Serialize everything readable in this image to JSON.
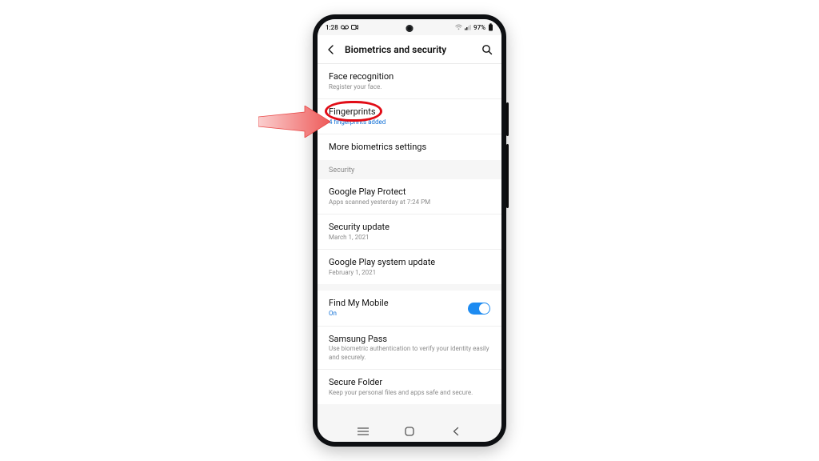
{
  "status": {
    "time": "1:28",
    "battery_pct": "97%"
  },
  "header": {
    "title": "Biometrics and security"
  },
  "items": {
    "face": {
      "title": "Face recognition",
      "sub": "Register your face."
    },
    "finger": {
      "title": "Fingerprints",
      "sub": "4 fingerprints added"
    },
    "more_bio": {
      "title": "More biometrics settings"
    },
    "section_security": "Security",
    "play_protect": {
      "title": "Google Play Protect",
      "sub": "Apps scanned yesterday at 7:24 PM"
    },
    "sec_update": {
      "title": "Security update",
      "sub": "March 1, 2021"
    },
    "play_sys_update": {
      "title": "Google Play system update",
      "sub": "February 1, 2021"
    },
    "find_mobile": {
      "title": "Find My Mobile",
      "sub": "On"
    },
    "samsung_pass": {
      "title": "Samsung Pass",
      "sub": "Use biometric authentication to verify your identity easily and securely."
    },
    "secure_folder": {
      "title": "Secure Folder",
      "sub": "Keep your personal files and apps safe and secure."
    }
  },
  "annotation": {
    "highlight_color": "#e10c16",
    "arrow_color": "#f6807f"
  }
}
